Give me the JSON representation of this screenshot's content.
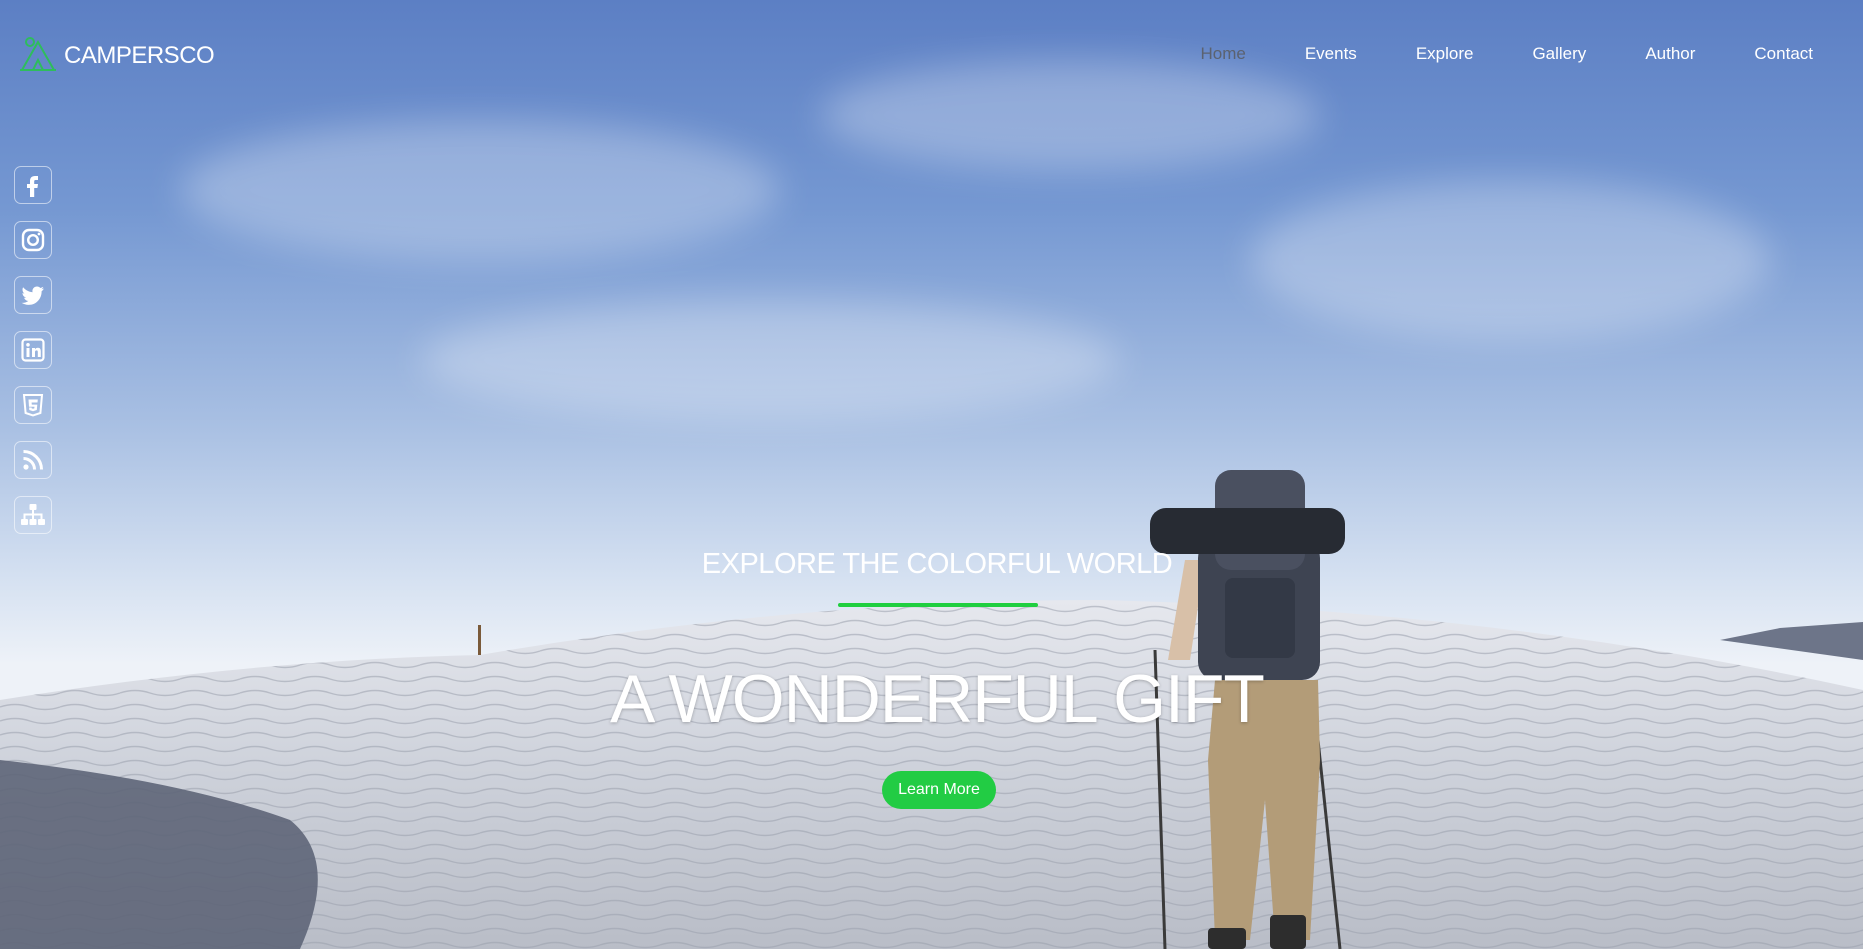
{
  "brand": {
    "name": "CAMPERSCO",
    "logo_icon": "camping-tent-icon",
    "accent": "#22cc44"
  },
  "nav": {
    "items": [
      {
        "label": "Home",
        "active": true
      },
      {
        "label": "Events"
      },
      {
        "label": "Explore"
      },
      {
        "label": "Gallery"
      },
      {
        "label": "Author"
      },
      {
        "label": "Contact"
      }
    ]
  },
  "social": [
    "facebook-icon",
    "instagram-icon",
    "twitter-icon",
    "linkedin-icon",
    "html5-icon",
    "rss-icon",
    "sitemap-icon"
  ],
  "hero": {
    "subtitle": "EXPLORE THE COLORFUL WORLD",
    "headline": "A WONDERFUL GIFT",
    "cta_label": "Learn More"
  },
  "colors": {
    "underline": "#1fcf3f",
    "button": "#22cc44",
    "active_nav": "#5b6270"
  }
}
